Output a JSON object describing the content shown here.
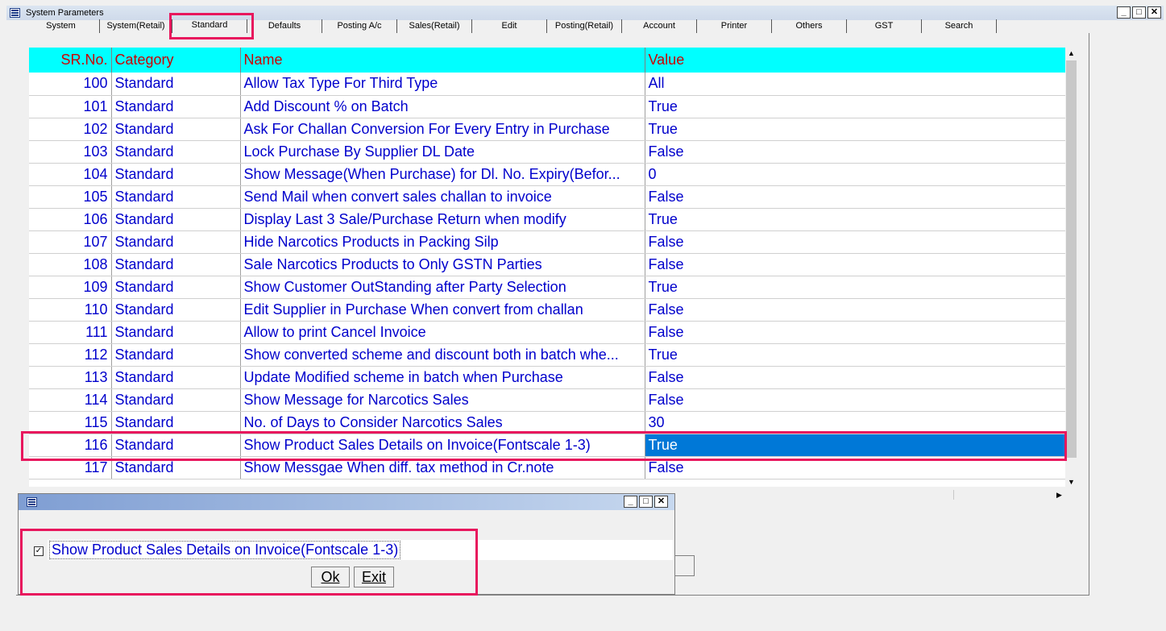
{
  "window": {
    "title": "System Parameters",
    "min": "_",
    "max": "□",
    "close": "✕"
  },
  "tabs": [
    "System",
    "System(Retail)",
    "Standard",
    "Defaults",
    "Posting A/c",
    "Sales(Retail)",
    "Edit",
    "Posting(Retail)",
    "Account",
    "Printer",
    "Others",
    "GST",
    "Search"
  ],
  "active_tab": "Standard",
  "grid": {
    "headers": {
      "sr": "SR.No.",
      "category": "Category",
      "name": "Name",
      "value": "Value"
    },
    "rows": [
      {
        "sr": "100",
        "category": "Standard",
        "name": "Allow Tax Type For Third Type",
        "value": "All"
      },
      {
        "sr": "101",
        "category": "Standard",
        "name": "Add Discount % on Batch",
        "value": "True"
      },
      {
        "sr": "102",
        "category": "Standard",
        "name": "Ask For Challan Conversion For Every Entry in Purchase",
        "value": "True"
      },
      {
        "sr": "103",
        "category": "Standard",
        "name": "Lock Purchase By Supplier DL Date",
        "value": "False"
      },
      {
        "sr": "104",
        "category": "Standard",
        "name": "Show Message(When Purchase) for Dl. No. Expiry(Befor...",
        "value": "0"
      },
      {
        "sr": "105",
        "category": "Standard",
        "name": "Send Mail when convert sales challan to invoice",
        "value": "False"
      },
      {
        "sr": "106",
        "category": "Standard",
        "name": "Display Last 3 Sale/Purchase Return when modify",
        "value": "True"
      },
      {
        "sr": "107",
        "category": "Standard",
        "name": "Hide Narcotics Products in Packing Silp",
        "value": "False"
      },
      {
        "sr": "108",
        "category": "Standard",
        "name": "Sale Narcotics Products to Only GSTN Parties",
        "value": "False"
      },
      {
        "sr": "109",
        "category": "Standard",
        "name": "Show Customer OutStanding after Party Selection",
        "value": "True"
      },
      {
        "sr": "110",
        "category": "Standard",
        "name": "Edit Supplier in Purchase When convert from challan",
        "value": "False"
      },
      {
        "sr": "111",
        "category": "Standard",
        "name": "Allow to print Cancel Invoice",
        "value": "False"
      },
      {
        "sr": "112",
        "category": "Standard",
        "name": "Show converted scheme and discount both in batch whe...",
        "value": "True"
      },
      {
        "sr": "113",
        "category": "Standard",
        "name": "Update Modified scheme in batch when Purchase",
        "value": "False"
      },
      {
        "sr": "114",
        "category": "Standard",
        "name": "Show Message for Narcotics Sales",
        "value": "False"
      },
      {
        "sr": "115",
        "category": "Standard",
        "name": "No. of Days to Consider Narcotics Sales",
        "value": "30"
      },
      {
        "sr": "116",
        "category": "Standard",
        "name": "Show Product Sales Details on Invoice(Fontscale 1-3)",
        "value": "True"
      },
      {
        "sr": "117",
        "category": "Standard",
        "name": "Show Messgae When diff. tax method in Cr.note",
        "value": "False"
      }
    ],
    "selected_sr": "116"
  },
  "dialog": {
    "checkbox_label": "Show Product Sales Details on Invoice(Fontscale 1-3)",
    "checked": true,
    "check_mark": "✓",
    "ok_label": "Ok",
    "exit_label": "Exit"
  },
  "colors": {
    "header_bg": "#00ffff",
    "header_text": "#cc0000",
    "cell_text": "#0000cc",
    "selection": "#0078d7",
    "highlight": "#e8175d"
  }
}
